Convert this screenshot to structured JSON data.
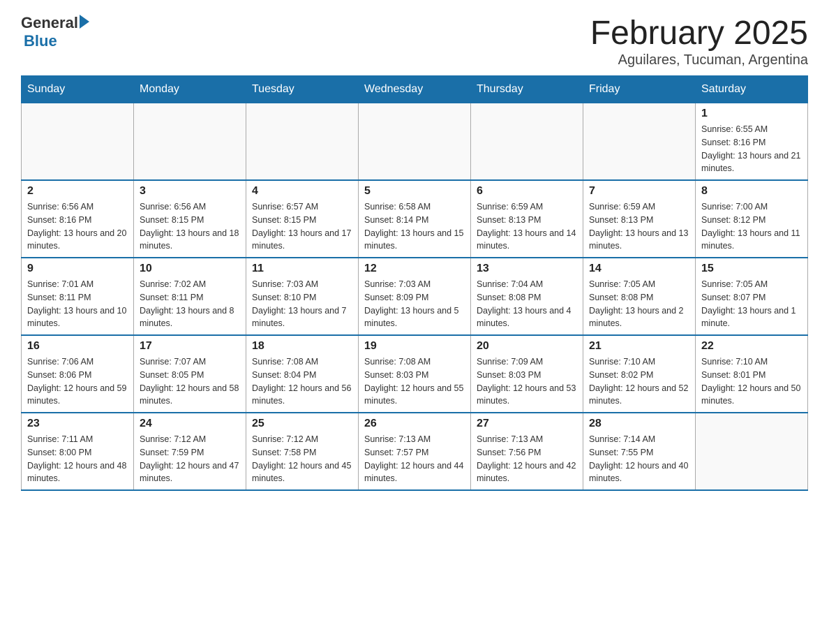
{
  "logo": {
    "text_general": "General",
    "text_blue": "Blue"
  },
  "title": "February 2025",
  "subtitle": "Aguilares, Tucuman, Argentina",
  "days_of_week": [
    "Sunday",
    "Monday",
    "Tuesday",
    "Wednesday",
    "Thursday",
    "Friday",
    "Saturday"
  ],
  "weeks": [
    [
      {
        "day": "",
        "info": ""
      },
      {
        "day": "",
        "info": ""
      },
      {
        "day": "",
        "info": ""
      },
      {
        "day": "",
        "info": ""
      },
      {
        "day": "",
        "info": ""
      },
      {
        "day": "",
        "info": ""
      },
      {
        "day": "1",
        "info": "Sunrise: 6:55 AM\nSunset: 8:16 PM\nDaylight: 13 hours and 21 minutes."
      }
    ],
    [
      {
        "day": "2",
        "info": "Sunrise: 6:56 AM\nSunset: 8:16 PM\nDaylight: 13 hours and 20 minutes."
      },
      {
        "day": "3",
        "info": "Sunrise: 6:56 AM\nSunset: 8:15 PM\nDaylight: 13 hours and 18 minutes."
      },
      {
        "day": "4",
        "info": "Sunrise: 6:57 AM\nSunset: 8:15 PM\nDaylight: 13 hours and 17 minutes."
      },
      {
        "day": "5",
        "info": "Sunrise: 6:58 AM\nSunset: 8:14 PM\nDaylight: 13 hours and 15 minutes."
      },
      {
        "day": "6",
        "info": "Sunrise: 6:59 AM\nSunset: 8:13 PM\nDaylight: 13 hours and 14 minutes."
      },
      {
        "day": "7",
        "info": "Sunrise: 6:59 AM\nSunset: 8:13 PM\nDaylight: 13 hours and 13 minutes."
      },
      {
        "day": "8",
        "info": "Sunrise: 7:00 AM\nSunset: 8:12 PM\nDaylight: 13 hours and 11 minutes."
      }
    ],
    [
      {
        "day": "9",
        "info": "Sunrise: 7:01 AM\nSunset: 8:11 PM\nDaylight: 13 hours and 10 minutes."
      },
      {
        "day": "10",
        "info": "Sunrise: 7:02 AM\nSunset: 8:11 PM\nDaylight: 13 hours and 8 minutes."
      },
      {
        "day": "11",
        "info": "Sunrise: 7:03 AM\nSunset: 8:10 PM\nDaylight: 13 hours and 7 minutes."
      },
      {
        "day": "12",
        "info": "Sunrise: 7:03 AM\nSunset: 8:09 PM\nDaylight: 13 hours and 5 minutes."
      },
      {
        "day": "13",
        "info": "Sunrise: 7:04 AM\nSunset: 8:08 PM\nDaylight: 13 hours and 4 minutes."
      },
      {
        "day": "14",
        "info": "Sunrise: 7:05 AM\nSunset: 8:08 PM\nDaylight: 13 hours and 2 minutes."
      },
      {
        "day": "15",
        "info": "Sunrise: 7:05 AM\nSunset: 8:07 PM\nDaylight: 13 hours and 1 minute."
      }
    ],
    [
      {
        "day": "16",
        "info": "Sunrise: 7:06 AM\nSunset: 8:06 PM\nDaylight: 12 hours and 59 minutes."
      },
      {
        "day": "17",
        "info": "Sunrise: 7:07 AM\nSunset: 8:05 PM\nDaylight: 12 hours and 58 minutes."
      },
      {
        "day": "18",
        "info": "Sunrise: 7:08 AM\nSunset: 8:04 PM\nDaylight: 12 hours and 56 minutes."
      },
      {
        "day": "19",
        "info": "Sunrise: 7:08 AM\nSunset: 8:03 PM\nDaylight: 12 hours and 55 minutes."
      },
      {
        "day": "20",
        "info": "Sunrise: 7:09 AM\nSunset: 8:03 PM\nDaylight: 12 hours and 53 minutes."
      },
      {
        "day": "21",
        "info": "Sunrise: 7:10 AM\nSunset: 8:02 PM\nDaylight: 12 hours and 52 minutes."
      },
      {
        "day": "22",
        "info": "Sunrise: 7:10 AM\nSunset: 8:01 PM\nDaylight: 12 hours and 50 minutes."
      }
    ],
    [
      {
        "day": "23",
        "info": "Sunrise: 7:11 AM\nSunset: 8:00 PM\nDaylight: 12 hours and 48 minutes."
      },
      {
        "day": "24",
        "info": "Sunrise: 7:12 AM\nSunset: 7:59 PM\nDaylight: 12 hours and 47 minutes."
      },
      {
        "day": "25",
        "info": "Sunrise: 7:12 AM\nSunset: 7:58 PM\nDaylight: 12 hours and 45 minutes."
      },
      {
        "day": "26",
        "info": "Sunrise: 7:13 AM\nSunset: 7:57 PM\nDaylight: 12 hours and 44 minutes."
      },
      {
        "day": "27",
        "info": "Sunrise: 7:13 AM\nSunset: 7:56 PM\nDaylight: 12 hours and 42 minutes."
      },
      {
        "day": "28",
        "info": "Sunrise: 7:14 AM\nSunset: 7:55 PM\nDaylight: 12 hours and 40 minutes."
      },
      {
        "day": "",
        "info": ""
      }
    ]
  ]
}
